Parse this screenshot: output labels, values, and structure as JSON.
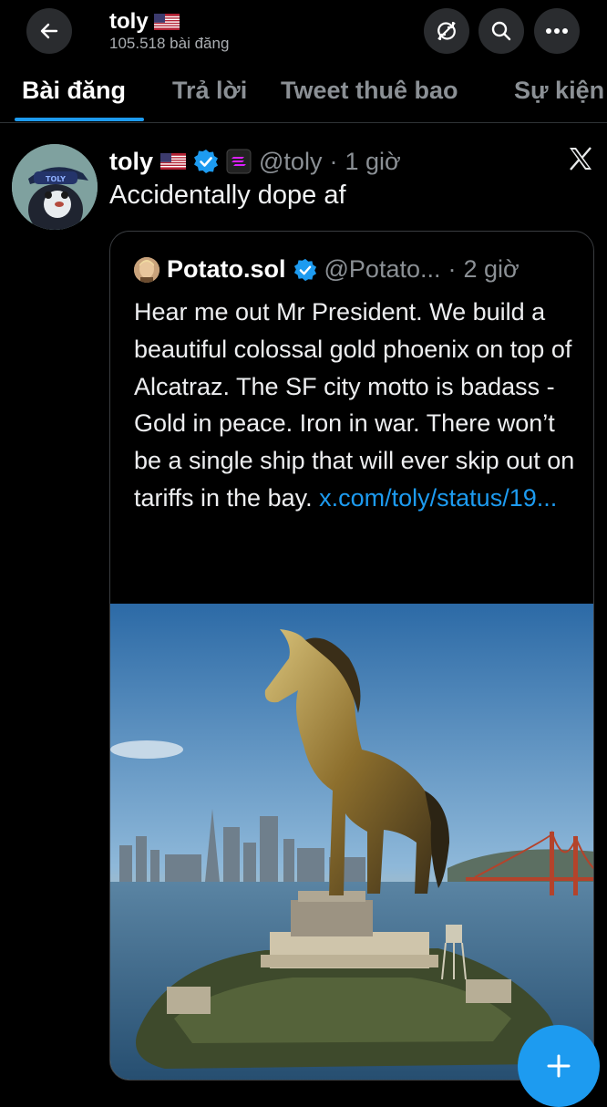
{
  "header": {
    "name": "toly",
    "post_count": "105.518 bài đăng",
    "icons": [
      "back-arrow-icon",
      "sync-icon",
      "search-icon",
      "more-icon"
    ]
  },
  "tabs": [
    {
      "label": "Bài đăng",
      "active": true
    },
    {
      "label": "Trả lời"
    },
    {
      "label": "Tweet thuê bao"
    },
    {
      "label": "Sự kiện"
    }
  ],
  "tweet": {
    "author": "toly",
    "handle": "@toly",
    "separator": "·",
    "time": "1 giờ",
    "text": "Accidentally dope af",
    "quote": {
      "author": "Potato.sol",
      "handle": "@Potato...",
      "separator": "·",
      "time": "2 giờ",
      "text": "Hear me out Mr President. We build a beautiful colossal gold phoenix on top of Alcatraz. The SF city motto is badass - Gold in peace. Iron in war.  There won’t be a single ship that will ever skip out on tariffs in the bay.",
      "link": "x.com/toly/status/19..."
    }
  },
  "colors": {
    "background": "#000000",
    "accent": "#1d9bf0",
    "muted": "#8b9095"
  }
}
